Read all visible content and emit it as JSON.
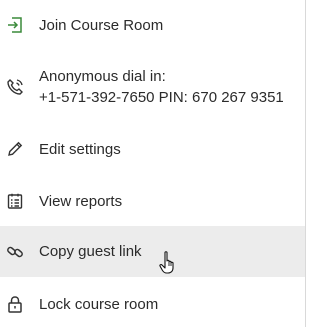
{
  "menu": {
    "join_label": "Join Course Room",
    "dial_title": "Anonymous dial in:",
    "dial_number": "+1-571-392-7650 PIN: 670 267 9351",
    "edit_label": "Edit settings",
    "reports_label": "View reports",
    "guest_label": "Copy guest link",
    "lock_label": "Lock course room"
  },
  "icons": {
    "join": "enter-icon",
    "dial": "phone-icon",
    "edit": "pencil-icon",
    "reports": "report-icon",
    "guest": "link-icon",
    "lock": "lock-icon",
    "cursor": "hand-pointer-icon"
  },
  "colors": {
    "join_icon": "#3a8a3a",
    "hover_bg": "#ececec",
    "text": "#2b2b2b"
  }
}
